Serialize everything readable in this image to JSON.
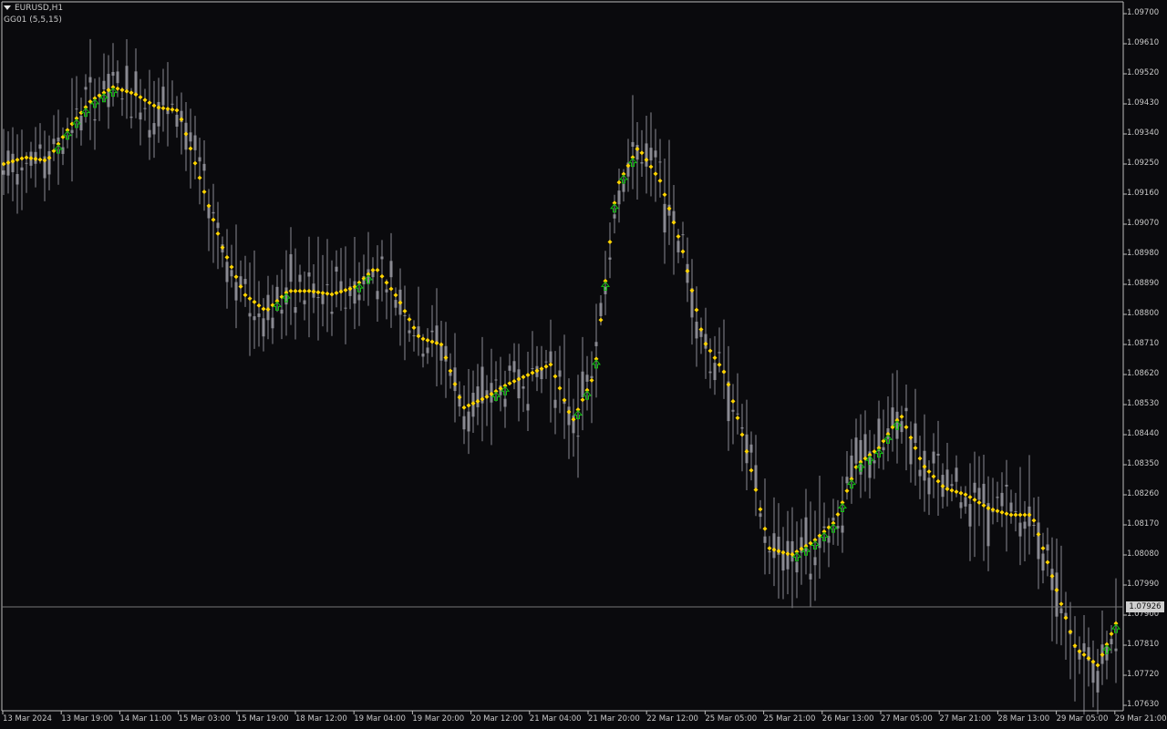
{
  "symbol_label": "EURUSD,H1",
  "indicator_label": "GG01 (5,5,15)",
  "current_price": "1.07926",
  "price_axis": [
    "1.09700",
    "1.09610",
    "1.09520",
    "1.09430",
    "1.09340",
    "1.09250",
    "1.09160",
    "1.09070",
    "1.08980",
    "1.08890",
    "1.08800",
    "1.08710",
    "1.08620",
    "1.08530",
    "1.08440",
    "1.08350",
    "1.08260",
    "1.08170",
    "1.08080",
    "1.07990",
    "1.07900",
    "1.07810",
    "1.07720",
    "1.07630"
  ],
  "time_axis": [
    "13 Mar 2024",
    "13 Mar 19:00",
    "14 Mar 11:00",
    "15 Mar 03:00",
    "15 Mar 19:00",
    "18 Mar 12:00",
    "19 Mar 04:00",
    "19 Mar 20:00",
    "20 Mar 12:00",
    "21 Mar 04:00",
    "21 Mar 20:00",
    "22 Mar 12:00",
    "25 Mar 05:00",
    "25 Mar 21:00",
    "26 Mar 13:00",
    "27 Mar 05:00",
    "27 Mar 21:00",
    "28 Mar 13:00",
    "29 Mar 05:00",
    "29 Mar 21:00"
  ],
  "colors": {
    "background": "#0a0a0d",
    "candles": "#8a8a92",
    "signal_line": "#ffd400",
    "up_arrow": "#10c010",
    "grid_line": "#777777"
  },
  "chart_data": {
    "type": "line",
    "title": "EURUSD,H1",
    "ylim": [
      1.0763,
      1.0975
    ],
    "series": [
      {
        "name": "GG01 (5,5,15)",
        "values": [
          1.0925,
          1.0927,
          1.0926,
          1.0936,
          1.0944,
          1.0948,
          1.0946,
          1.0942,
          1.0941,
          1.092,
          1.09,
          1.0886,
          1.0881,
          1.0887,
          1.0887,
          1.0886,
          1.0888,
          1.0894,
          1.0885,
          1.0873,
          1.0871,
          1.0852,
          1.0855,
          1.0859,
          1.0862,
          1.0865,
          1.0848,
          1.0862,
          1.0918,
          1.093,
          1.092,
          1.09,
          1.0872,
          1.0862,
          1.0838,
          1.081,
          1.0808,
          1.0812,
          1.0818,
          1.0835,
          1.084,
          1.085,
          1.0835,
          1.0828,
          1.0826,
          1.0822,
          1.082,
          1.082,
          1.08,
          1.078,
          1.0775,
          1.079
        ]
      }
    ]
  }
}
